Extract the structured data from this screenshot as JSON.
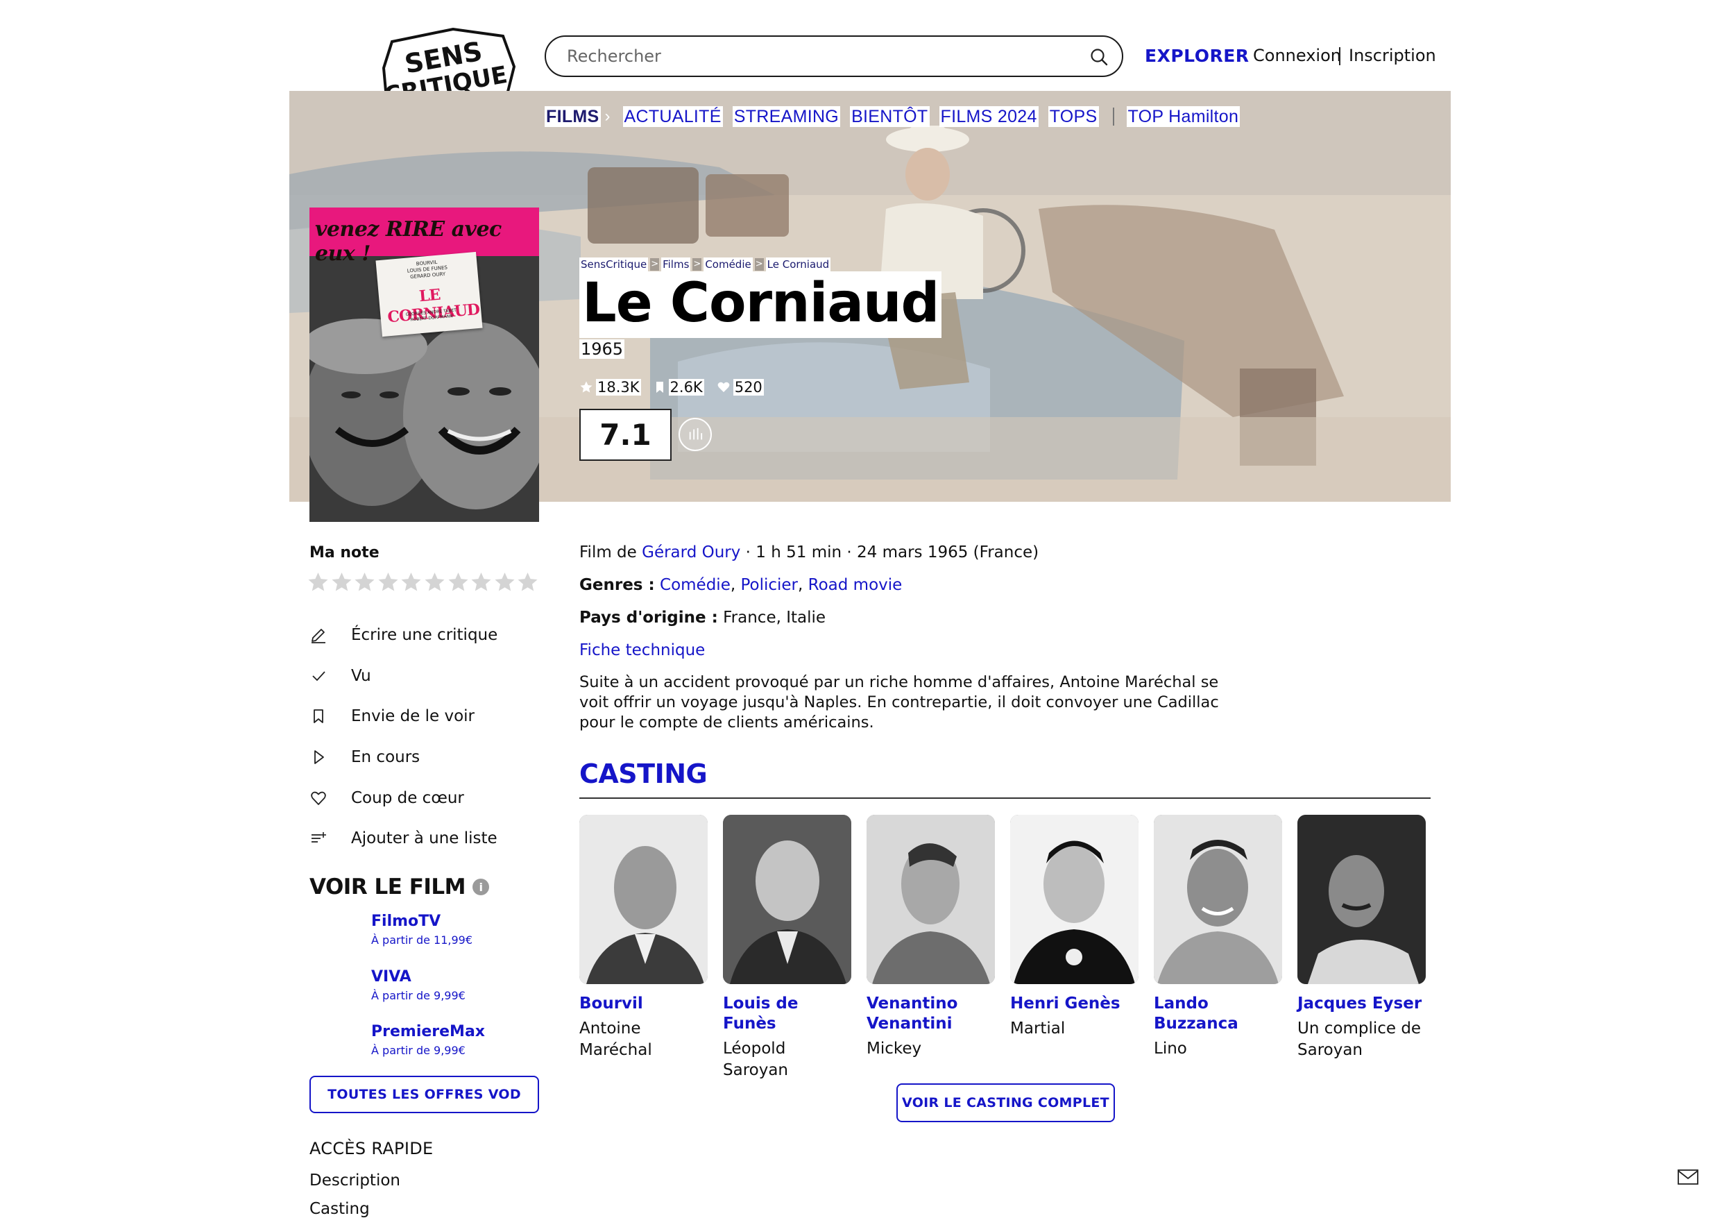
{
  "header": {
    "logo_lines": [
      "SENS",
      "CRITIQUE"
    ],
    "search_placeholder": "Rechercher",
    "explorer": "EXPLORER",
    "connexion": "Connexion",
    "inscription": "Inscription"
  },
  "nav": {
    "section": "FILMS",
    "items": [
      "ACTUALITÉ",
      "STREAMING",
      "BIENTÔT",
      "FILMS 2024",
      "TOPS"
    ],
    "extra": "TOP Hamilton"
  },
  "poster": {
    "tagline": "venez RIRE avec eux !",
    "credits_top": [
      "BOURVIL",
      "LOUIS DE FUNES",
      "GERARD OURY"
    ],
    "title": "LE CORNIAUD",
    "credits_bottom": [
      "GEORGES ANDRE TABET",
      "ROBERT DORFMANN"
    ]
  },
  "breadcrumb": [
    "SensCritique",
    "Films",
    "Comédie",
    "Le Corniaud"
  ],
  "movie": {
    "title": "Le Corniaud",
    "year": "1965",
    "ratings_count": "18.3K",
    "wishlist_count": "2.6K",
    "favorites_count": "520",
    "score": "7.1",
    "director_prefix": "Film de",
    "director": "Gérard Oury",
    "details": "· 1 h 51 min · 24 mars 1965 (France)",
    "genres_label": "Genres :",
    "genres": [
      "Comédie",
      "Policier",
      "Road movie"
    ],
    "country_label": "Pays d'origine :",
    "countries": "France, Italie",
    "fiche": "Fiche technique",
    "synopsis": "Suite à un accident provoqué par un riche homme d'affaires, Antoine Maréchal se voit offrir un voyage jusqu'à Naples. En contrepartie, il doit convoyer une Cadillac pour le compte de clients américains."
  },
  "sidebar": {
    "ma_note": "Ma note",
    "stars_total": 10,
    "actions": [
      {
        "label": "Écrire une critique",
        "icon": "pencil-icon"
      },
      {
        "label": "Vu",
        "icon": "check-icon"
      },
      {
        "label": "Envie de le voir",
        "icon": "bookmark-icon"
      },
      {
        "label": "En cours",
        "icon": "play-icon"
      },
      {
        "label": "Coup de cœur",
        "icon": "heart-icon"
      },
      {
        "label": "Ajouter à une liste",
        "icon": "list-add-icon"
      }
    ],
    "voir_film": "VOIR LE FILM",
    "info_glyph": "i",
    "offers": [
      {
        "name": "FilmoTV",
        "price": "À partir de 11,99€"
      },
      {
        "name": "VIVA",
        "price": "À partir de 9,99€"
      },
      {
        "name": "PremiereMax",
        "price": "À partir de 9,99€"
      }
    ],
    "all_offers": "TOUTES LES OFFRES VOD",
    "acces_rapide": "ACCÈS RAPIDE",
    "quick_links": [
      "Description",
      "Casting"
    ]
  },
  "casting": {
    "heading": "CASTING",
    "cast": [
      {
        "actor": "Bourvil",
        "role": "Antoine Maréchal"
      },
      {
        "actor": "Louis de Funès",
        "role": "Léopold Saroyan"
      },
      {
        "actor": "Venantino Venantini",
        "role": "Mickey"
      },
      {
        "actor": "Henri Genès",
        "role": "Martial"
      },
      {
        "actor": "Lando Buzzanca",
        "role": "Lino"
      },
      {
        "actor": "Jacques Eyser",
        "role": "Un complice de Saroyan"
      }
    ],
    "full_button": "VOIR LE CASTING COMPLET"
  },
  "colors": {
    "accent": "#1515c8",
    "nav_active": "#1e1b6e",
    "poster_pink": "#e8187d",
    "text": "#111111"
  }
}
